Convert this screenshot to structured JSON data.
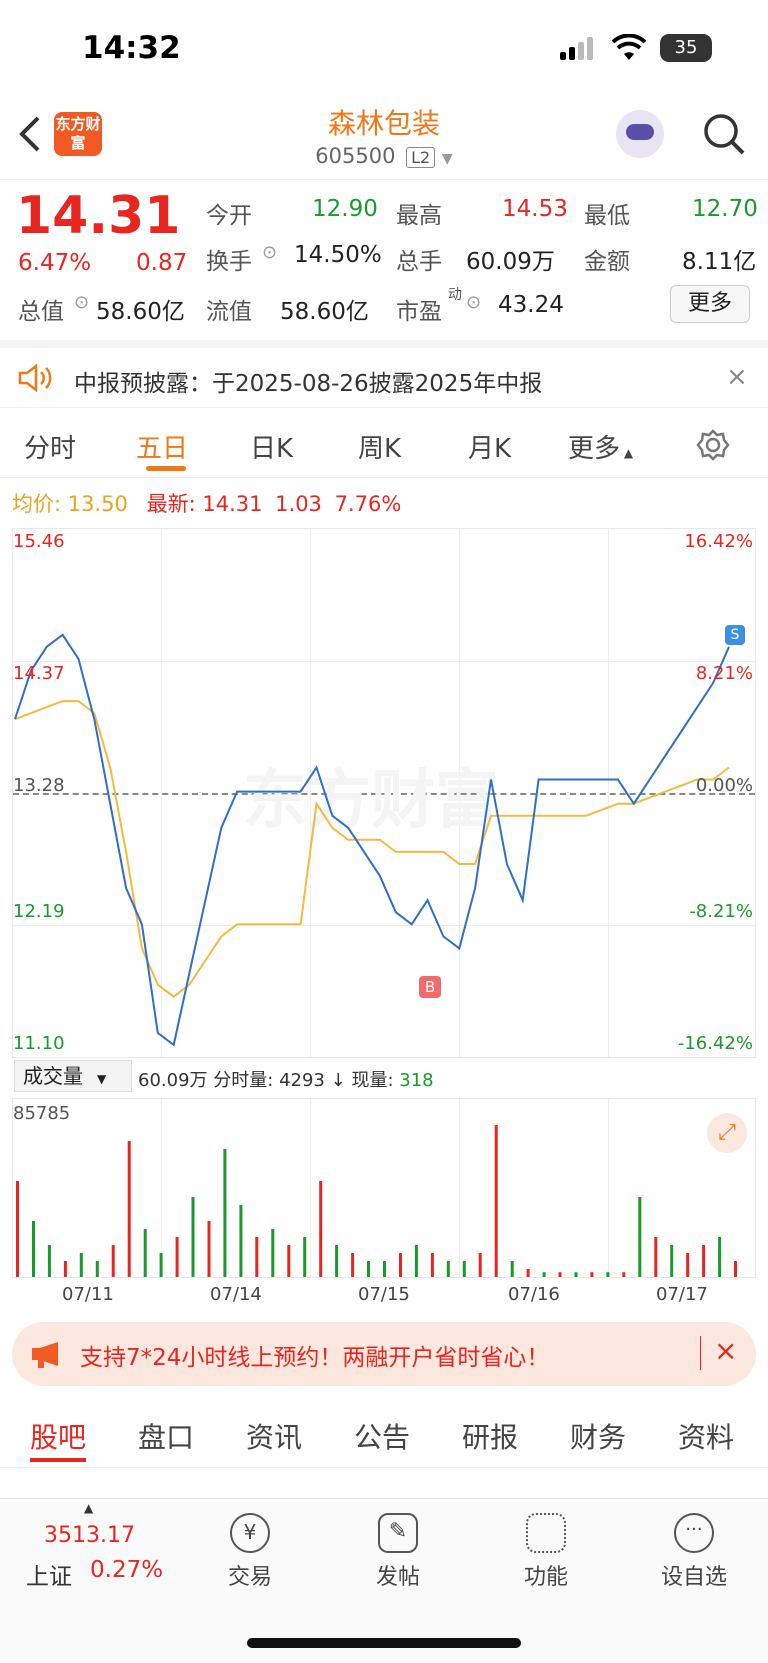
{
  "status_bar": {
    "time": "14:32",
    "battery": "35"
  },
  "header": {
    "logo_text": "东方财富",
    "stock_name": "森林包装",
    "stock_code": "605500",
    "level_badge": "L2"
  },
  "quote": {
    "price": "14.31",
    "change_pct": "6.47%",
    "change_amt": "0.87",
    "open_label": "今开",
    "open": "12.90",
    "high_label": "最高",
    "high": "14.53",
    "low_label": "最低",
    "low": "12.70",
    "turnover_label": "换手",
    "turnover": "14.50%",
    "volume_label": "总手",
    "volume": "60.09万",
    "amount_label": "金额",
    "amount": "8.11亿",
    "mcap_label": "总值",
    "mcap": "58.60亿",
    "float_label": "流值",
    "float": "58.60亿",
    "pe_label": "市盈",
    "pe_sup": "动",
    "pe": "43.24",
    "more_label": "更多"
  },
  "notice": {
    "text": "中报预披露：于2025-08-26披露2025年中报"
  },
  "tabs": [
    "分时",
    "五日",
    "日K",
    "周K",
    "月K",
    "更多"
  ],
  "chart_info": {
    "avg_label": "均价:",
    "avg": "13.50",
    "latest_label": "最新:",
    "latest": "14.31",
    "chg": "1.03",
    "chg_pct": "7.76%"
  },
  "chart_data": {
    "type": "line",
    "x": [
      "07/11",
      "07/14",
      "07/15",
      "07/16",
      "07/17"
    ],
    "y_ticks_left": [
      "15.46",
      "14.37",
      "13.28",
      "12.19",
      "11.10"
    ],
    "y_ticks_right": [
      "16.42%",
      "8.21%",
      "0.00%",
      "-8.21%",
      "-16.42%"
    ],
    "ylim": [
      11.1,
      15.46
    ],
    "series": [
      {
        "name": "",
        "values": [
          13.9,
          14.3,
          14.5,
          14.6,
          14.4,
          13.9,
          13.2,
          12.5,
          12.2,
          11.3,
          11.2,
          11.8,
          12.4,
          13.0,
          13.3,
          13.3,
          13.3,
          13.3,
          13.3,
          13.5,
          13.1,
          13.0,
          12.8,
          12.6,
          12.3,
          12.2,
          12.4,
          12.1,
          12.0,
          12.5,
          13.4,
          12.7,
          12.4,
          13.4,
          13.4,
          13.4,
          13.4,
          13.4,
          13.4,
          13.2,
          13.4,
          13.6,
          13.8,
          14.0,
          14.2,
          14.5
        ]
      },
      {
        "name": "",
        "values": [
          13.9,
          13.95,
          14.0,
          14.05,
          14.05,
          13.95,
          13.5,
          12.8,
          12.0,
          11.7,
          11.6,
          11.7,
          11.9,
          12.1,
          12.2,
          12.2,
          12.2,
          12.2,
          12.2,
          13.2,
          13.0,
          12.9,
          12.9,
          12.9,
          12.8,
          12.8,
          12.8,
          12.8,
          12.7,
          12.7,
          13.1,
          13.1,
          13.1,
          13.1,
          13.1,
          13.1,
          13.1,
          13.15,
          13.2,
          13.2,
          13.25,
          13.3,
          13.35,
          13.4,
          13.4,
          13.5
        ]
      }
    ],
    "markers": [
      "S",
      "B"
    ]
  },
  "volume": {
    "selector": "成交量",
    "total": "60.09万",
    "label1": "分时量:",
    "v1": "4293",
    "arrow": "↓",
    "label2": "现量:",
    "v2": "318",
    "max": "85785",
    "bars": [
      0.6,
      0.35,
      0.2,
      0.1,
      0.15,
      0.1,
      0.2,
      0.85,
      0.3,
      0.15,
      0.25,
      0.5,
      0.35,
      0.8,
      0.45,
      0.25,
      0.3,
      0.2,
      0.25,
      0.6,
      0.2,
      0.15,
      0.1,
      0.1,
      0.15,
      0.2,
      0.15,
      0.1,
      0.1,
      0.15,
      0.95,
      0.1,
      0.05,
      0.03,
      0.03,
      0.03,
      0.03,
      0.03,
      0.03,
      0.5,
      0.25,
      0.2,
      0.15,
      0.2,
      0.25,
      0.1
    ],
    "up_flags": [
      1,
      0,
      0,
      1,
      0,
      0,
      1,
      1,
      0,
      0,
      1,
      0,
      1,
      0,
      0,
      1,
      0,
      1,
      0,
      1,
      0,
      1,
      0,
      0,
      1,
      0,
      1,
      0,
      0,
      1,
      1,
      0,
      1,
      0,
      1,
      0,
      1,
      0,
      1,
      0,
      1,
      0,
      1,
      1,
      0,
      1
    ]
  },
  "banner": {
    "text": "支持7*24小时线上预约！两融开户省时省心！"
  },
  "bottom_tabs": [
    "股吧",
    "盘口",
    "资讯",
    "公告",
    "研报",
    "财务",
    "资料"
  ],
  "bottom_bar": {
    "index_value": "3513.17",
    "index_name": "上证",
    "index_pct": "0.27%",
    "trade": "交易",
    "post": "发帖",
    "function": "功能",
    "watch": "设自选"
  },
  "colors": {
    "accent": "#f07818",
    "up": "#e8261f",
    "down": "#1a9a2b",
    "price_line": "#2f6fc4",
    "avg_line": "#f5b942"
  }
}
